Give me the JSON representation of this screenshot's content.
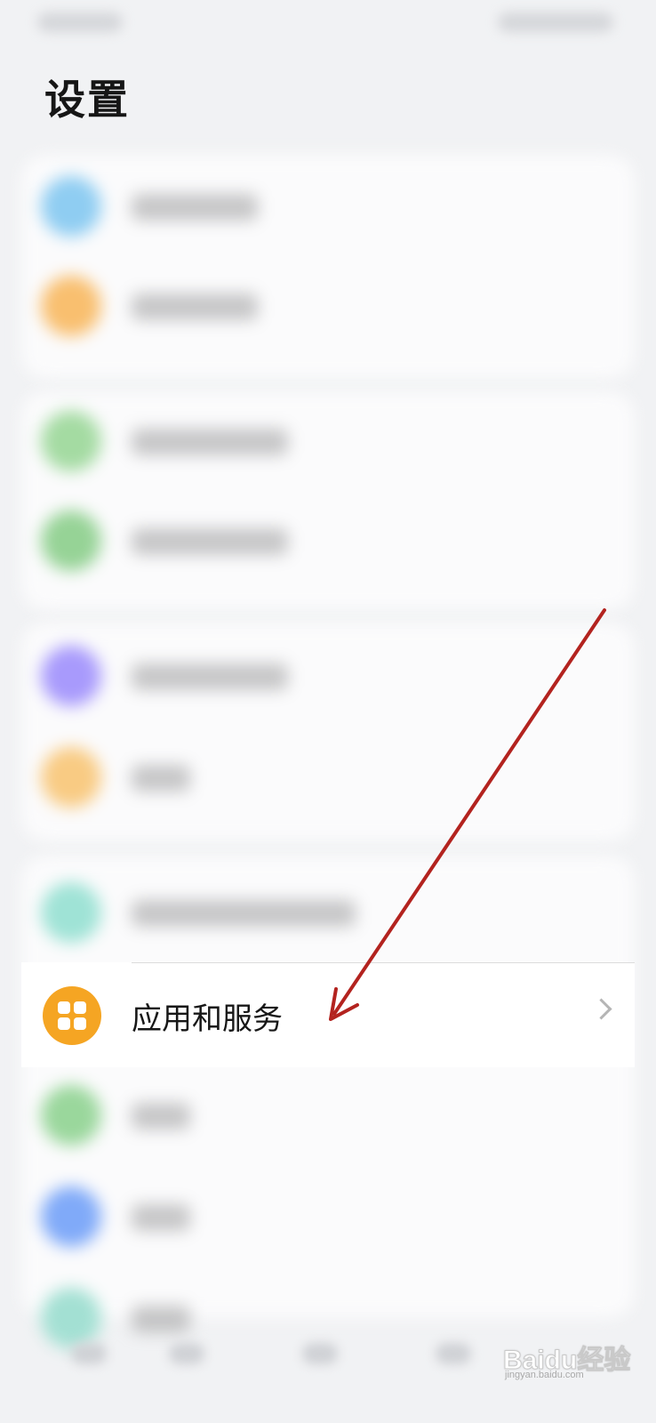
{
  "header": {
    "title": "设置"
  },
  "focused_item": {
    "label": "应用和服务",
    "icon": "apps-icon",
    "icon_color": "#f5a523",
    "chevron": "chevron-right-icon"
  },
  "blurred_icon_colors": [
    "#8fcdf2",
    "#f9bf6f",
    "#a4dba2",
    "#96d396",
    "#a89afc",
    "#f9cb83",
    "#9fe3d6",
    "#9ad79c",
    "#80aaf9",
    "#a3e0d3"
  ],
  "annotation": {
    "arrow_color": "#b3231f"
  },
  "watermark": {
    "brand": "Baidu经验",
    "sub": "jingyan.baidu.com"
  }
}
